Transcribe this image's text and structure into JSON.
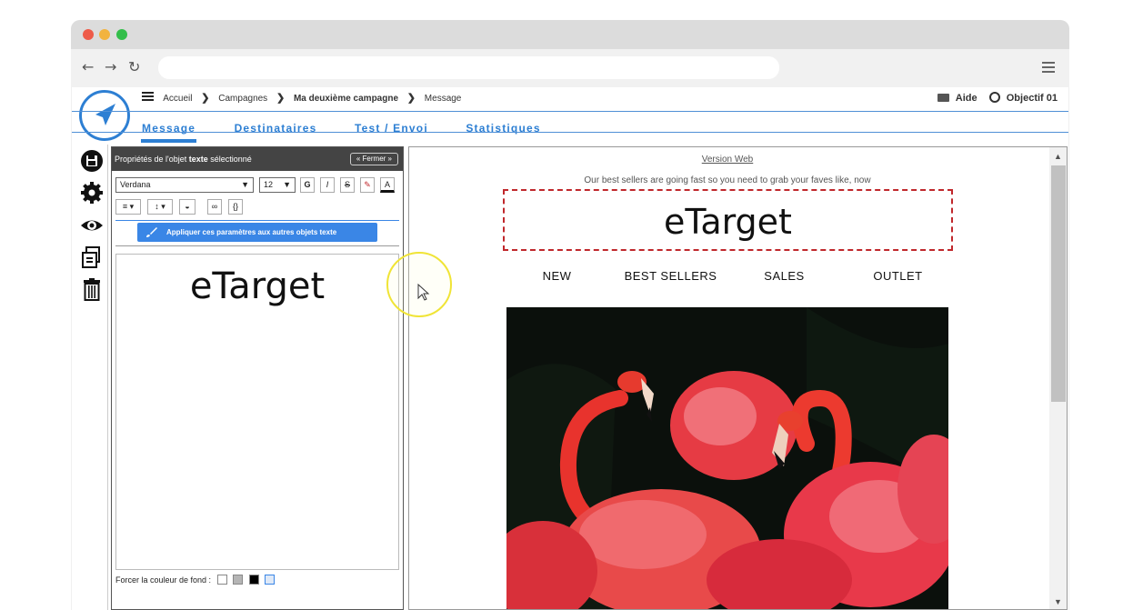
{
  "browser": {
    "back_glyph": "←",
    "forward_glyph": "→",
    "reload_glyph": "↻",
    "address": "",
    "icons": [
      "back-icon",
      "forward-icon",
      "reload-icon",
      "menu-icon"
    ]
  },
  "breadcrumb": {
    "items": [
      "Accueil",
      "Campagnes",
      "Ma deuxième campagne",
      "Message"
    ],
    "separator": "❯"
  },
  "top_right": {
    "help_label": "Aide",
    "user_label": "Objectif 01"
  },
  "tabs": [
    {
      "label": "Message",
      "active": true
    },
    {
      "label": "Destinataires",
      "active": false
    },
    {
      "label": "Test / Envoi",
      "active": false
    },
    {
      "label": "Statistiques",
      "active": false
    }
  ],
  "sidebar_icons": [
    "save-icon",
    "settings-icon",
    "preview-icon",
    "duplicate-icon",
    "trash-icon"
  ],
  "panel": {
    "title_prefix": "Propriétés de l'objet ",
    "title_bold": "texte",
    "title_suffix": " sélectionné",
    "close_label": "Fermer",
    "font_value": "Verdana",
    "size_value": "12",
    "bold_label": "G",
    "italic_label": "I",
    "strike_label": "S",
    "color_label": "A",
    "code_label": "{}",
    "apply_label": "Appliquer ces paramètres aux autres objets texte",
    "editor_text": "eTarget",
    "bg_label": "Forcer la couleur de fond :"
  },
  "preview": {
    "version_web": "Version Web",
    "teaser": "Our best sellers are going fast so you need to grab your faves like, now",
    "title": "eTarget",
    "menu": [
      "NEW",
      "BEST SELLERS",
      "SALES",
      "OUTLET"
    ]
  },
  "colors": {
    "accent": "#2d7fd3",
    "apply_button": "#3a86e6",
    "dashed_border": "#c0282c",
    "panel_header": "#444444"
  }
}
